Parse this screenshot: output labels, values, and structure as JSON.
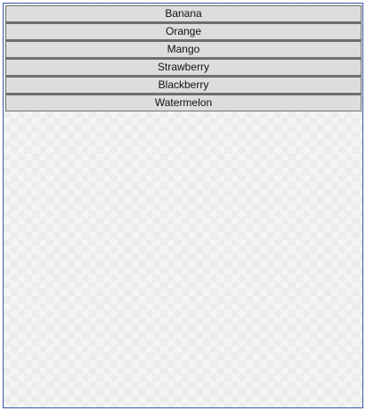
{
  "list": {
    "items": [
      {
        "label": "Banana"
      },
      {
        "label": "Orange"
      },
      {
        "label": "Mango"
      },
      {
        "label": "Strawberry"
      },
      {
        "label": "Blackberry"
      },
      {
        "label": "Watermelon"
      }
    ]
  }
}
